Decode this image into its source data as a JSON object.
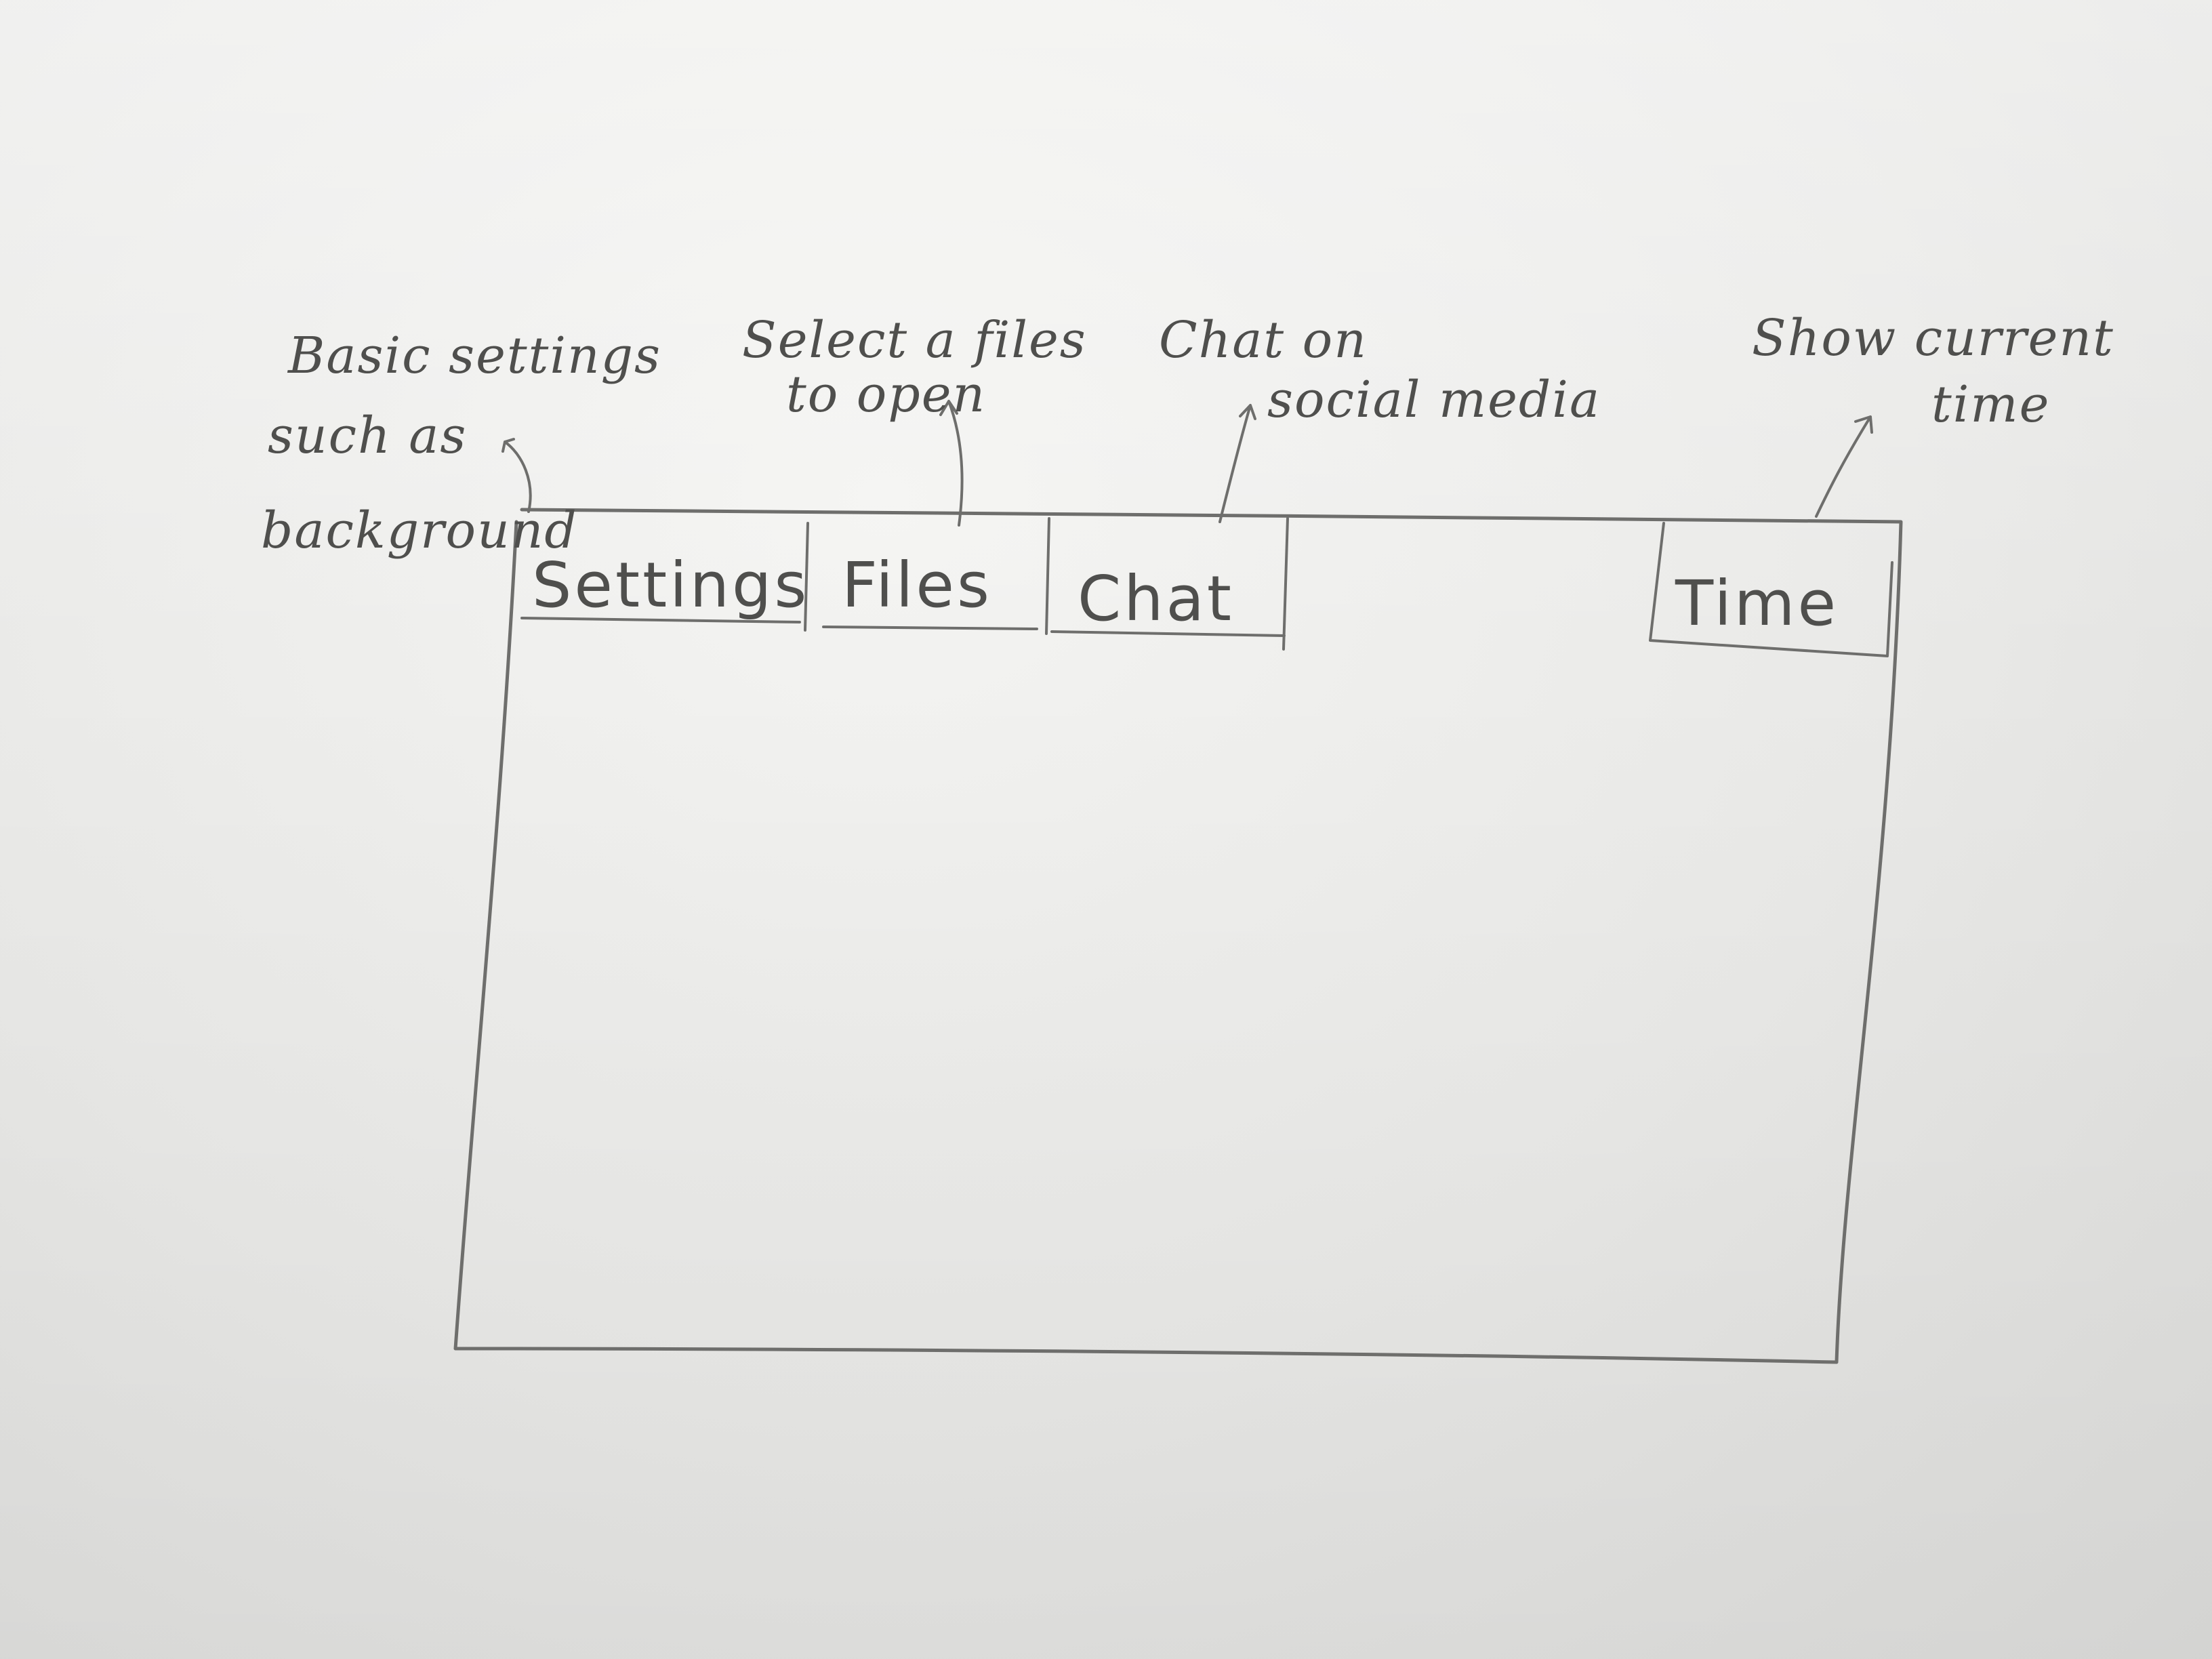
{
  "menu_bar": {
    "tabs": [
      {
        "id": "settings",
        "label": "Settings"
      },
      {
        "id": "files",
        "label": "Files"
      },
      {
        "id": "chat",
        "label": "Chat"
      }
    ],
    "time_label": "Time"
  },
  "annotations": {
    "settings": [
      "Basic settings",
      "such as",
      "background"
    ],
    "files": [
      "Select a files",
      "to open"
    ],
    "chat": [
      "Chat on",
      "social media"
    ],
    "time": [
      "Show current",
      "time"
    ]
  }
}
